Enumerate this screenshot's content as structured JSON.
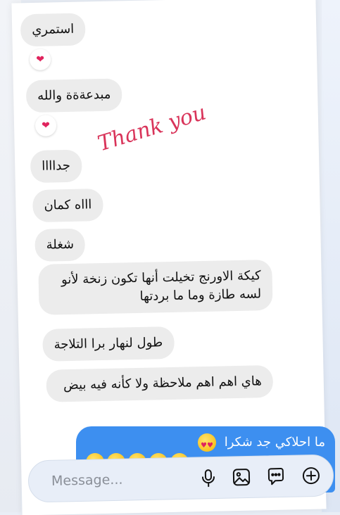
{
  "messages_received": [
    {
      "text": "استمري",
      "reaction": "heart"
    },
    {
      "text": "مبدعةةة والله",
      "reaction": "heart"
    },
    {
      "text": "جداااا"
    },
    {
      "text": "اااه كمان"
    },
    {
      "text": "شغلة"
    },
    {
      "text": "كيكة الاورنج تخيلت أنها تكون زنخة لأنو لسه طازة وما ما بردتها"
    },
    {
      "text": "طول لنهار برا التلاجة"
    },
    {
      "text": "هاي اهم اهم ملاحظة ولا كأنه فيه بيض"
    }
  ],
  "overlay_text": "Thank you",
  "message_sent": {
    "text": "ما احلاكي جد شكرا",
    "emoji": "heart-eyes",
    "emoji_count": 5
  },
  "composer": {
    "placeholder": "Message..."
  },
  "icons": [
    "heart-icon",
    "heart-eyes-emoji",
    "microphone-icon",
    "image-icon",
    "chat-bubble-icon",
    "plus-circle-icon"
  ],
  "colors": {
    "sent_bubble": "#3d8ff0",
    "received_bubble": "#ececec",
    "overlay": "#d9345a",
    "heart": "#e0245e"
  }
}
